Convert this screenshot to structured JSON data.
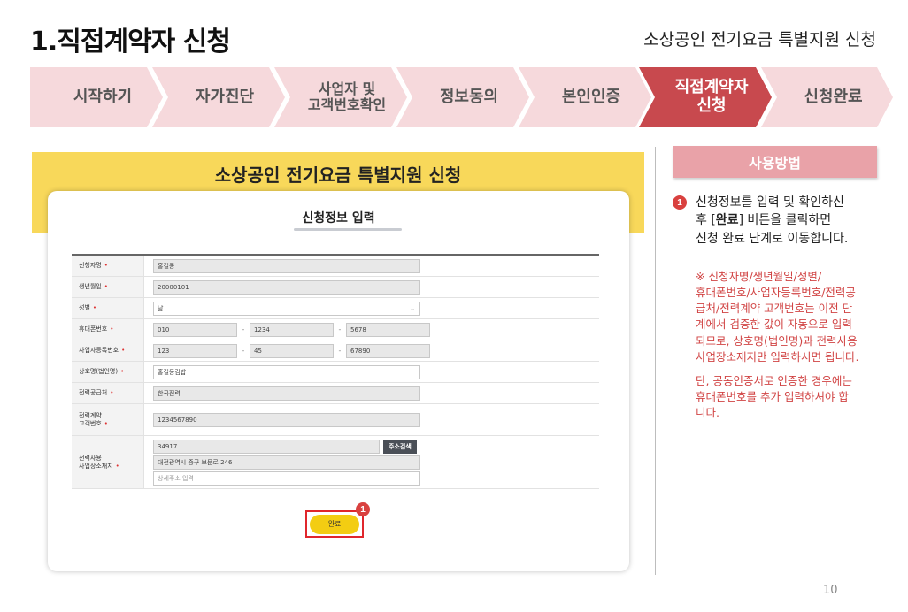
{
  "slide": {
    "title": "1.직접계약자 신청",
    "subtitle": "소상공인 전기요금 특별지원 신청",
    "page_number": "10"
  },
  "steps": [
    {
      "label_line1": "시작하기",
      "label_line2": "",
      "active": false
    },
    {
      "label_line1": "자가진단",
      "label_line2": "",
      "active": false
    },
    {
      "label_line1": "사업자 및",
      "label_line2": "고객번호확인",
      "active": false
    },
    {
      "label_line1": "정보동의",
      "label_line2": "",
      "active": false
    },
    {
      "label_line1": "본인인증",
      "label_line2": "",
      "active": false
    },
    {
      "label_line1": "직접계약자",
      "label_line2": "신청",
      "active": true
    },
    {
      "label_line1": "신청완료",
      "label_line2": "",
      "active": false
    }
  ],
  "colors": {
    "step_inactive": "#f6d9dc",
    "step_active": "#c8494e",
    "banner": "#f8d85a",
    "done_button": "#f3cd12",
    "highlight_border": "#e0262c",
    "help_header": "#e9a2a8",
    "note_text": "#d14444"
  },
  "app": {
    "banner_title": "소상공인 전기요금 특별지원 신청",
    "form_title": "신청정보 입력",
    "fields": {
      "applicant_name": {
        "label": "신청자명",
        "value": "홍길동"
      },
      "birth_date": {
        "label": "생년월일",
        "value": "20000101"
      },
      "gender": {
        "label": "성별",
        "value": "남"
      },
      "mobile": {
        "label": "휴대폰번호",
        "part1": "010",
        "part2": "1234",
        "part3": "5678"
      },
      "business_reg": {
        "label": "사업자등록번호",
        "part1": "123",
        "part2": "45",
        "part3": "67890"
      },
      "company_name": {
        "label": "상호명(법인명)",
        "value": "홍길동김밥"
      },
      "power_supplier": {
        "label": "전력공급처",
        "value": "한국전력"
      },
      "customer_no": {
        "label_line1": "전력계약",
        "label_line2": "고객번호",
        "value": "1234567890"
      },
      "address": {
        "label_line1": "전력사용",
        "label_line2": "사업장소재지",
        "zipcode": "34917",
        "search_button": "주소검색",
        "address1": "대전광역시 중구 보문로 246",
        "detail_placeholder": "상세주소 입력"
      }
    },
    "done_button": "완료",
    "marker": "1"
  },
  "help": {
    "header": "사용방법",
    "marker": "1",
    "line1": "신청정보를 입력 및 확인하신",
    "line2_pre": "후 [",
    "line2_bold": "완료",
    "line2_post": "] 버튼을 클릭하면",
    "line3": "신청 완료 단계로 이동합니다.",
    "note_lines": [
      "※ 신청자명/생년월일/성별/",
      "휴대폰번호/사업자등록번호/전력공",
      "급처/전력계약 고객번호는 이전 단",
      "계에서 검증한 값이 자동으로 입력",
      "되므로, 상호명(법인명)과 전력사용",
      "사업장소재지만 입력하시면 됩니다."
    ],
    "note2_lines": [
      "단, 공동인증서로 인증한 경우에는",
      "휴대폰번호를 추가 입력하셔야 합",
      "니다."
    ]
  }
}
